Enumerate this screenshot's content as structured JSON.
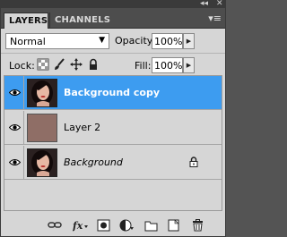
{
  "tabs": [
    {
      "label": "LAYERS",
      "active": true
    },
    {
      "label": "CHANNELS",
      "active": false
    }
  ],
  "titlebar": {
    "collapse_icon": "double-chevron-left-icon",
    "close_icon": "close-icon"
  },
  "panel_menu_icon": "panel-menu-icon",
  "blend_mode": {
    "value": "Normal"
  },
  "opacity": {
    "label": "Opacity:",
    "value": "100%"
  },
  "lock": {
    "label": "Lock:",
    "icons": [
      "lock-transparent-pixels-icon",
      "lock-image-pixels-icon",
      "lock-position-icon",
      "lock-all-icon"
    ]
  },
  "fill": {
    "label": "Fill:",
    "value": "100%"
  },
  "layers": [
    {
      "name": "Background copy",
      "visible": true,
      "selected": true,
      "italic": false,
      "locked": false,
      "thumbnail": "portrait"
    },
    {
      "name": "Layer 2",
      "visible": true,
      "selected": false,
      "italic": false,
      "locked": false,
      "thumbnail": "solid-color"
    },
    {
      "name": "Background",
      "visible": true,
      "selected": false,
      "italic": true,
      "locked": true,
      "thumbnail": "portrait"
    }
  ],
  "colors": {
    "selection": "#3d9cf0",
    "panel_bg": "#d6d6d6",
    "tab_bar_bg": "#4d4d4d",
    "layer2_fill": "#8f6e66"
  },
  "bottom_tools": [
    "link-layers-icon",
    "layer-style-icon",
    "layer-mask-icon",
    "adjustment-layer-icon",
    "new-group-icon",
    "new-layer-icon",
    "delete-layer-icon"
  ]
}
